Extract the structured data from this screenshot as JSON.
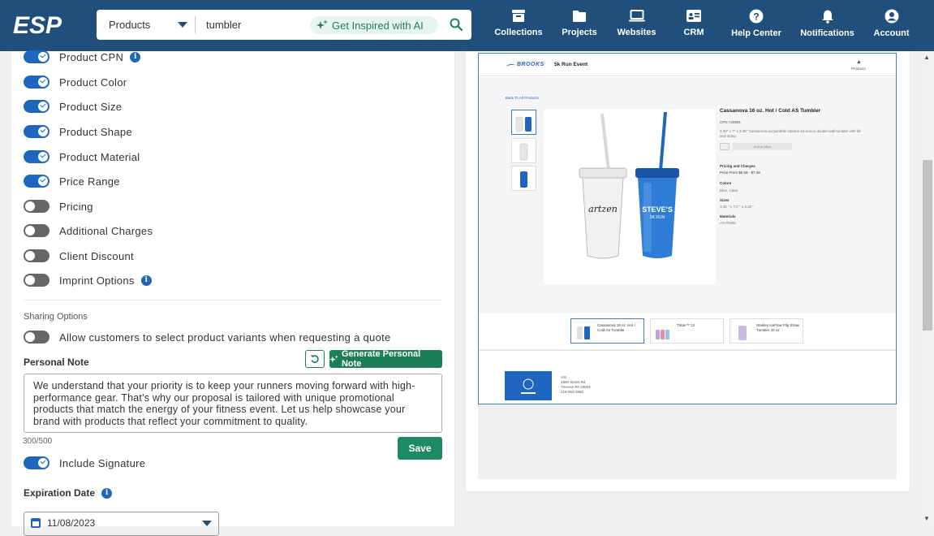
{
  "header": {
    "logo_text": "ESP",
    "search": {
      "scope": "Products",
      "query": "tumbler",
      "ai_label": "Get Inspired with AI"
    },
    "nav": [
      {
        "label": "Collections",
        "icon": "archive-box-icon"
      },
      {
        "label": "Projects",
        "icon": "folder-icon"
      },
      {
        "label": "Websites",
        "icon": "monitor-icon"
      },
      {
        "label": "CRM",
        "icon": "id-card-icon"
      },
      {
        "label": "Help Center",
        "icon": "help-circle-icon"
      },
      {
        "label": "Notifications",
        "icon": "bell-icon"
      },
      {
        "label": "Account",
        "icon": "user-circle-icon"
      }
    ]
  },
  "options": [
    {
      "label": "Product CPN",
      "on": true,
      "info": true
    },
    {
      "label": "Product Color",
      "on": true,
      "info": false
    },
    {
      "label": "Product Size",
      "on": true,
      "info": false
    },
    {
      "label": "Product Shape",
      "on": true,
      "info": false
    },
    {
      "label": "Product Material",
      "on": true,
      "info": false
    },
    {
      "label": "Price Range",
      "on": true,
      "info": false
    },
    {
      "label": "Pricing",
      "on": false,
      "info": false
    },
    {
      "label": "Additional Charges",
      "on": false,
      "info": false
    },
    {
      "label": "Client Discount",
      "on": false,
      "info": false
    },
    {
      "label": "Imprint Options",
      "on": false,
      "info": true
    }
  ],
  "sharing": {
    "heading": "Sharing Options",
    "variant_toggle_label": "Allow customers to select product variants when requesting a quote",
    "variant_toggle_on": false
  },
  "personal_note": {
    "heading": "Personal Note",
    "generate_label": "Generate Personal Note",
    "text": "We understand that your priority is to keep your runners moving forward with high-performance gear. That's why our proposal is tailored with unique promotional products that match the energy of your fitness event. Let us help showcase your brand with products that reflect your commitment to quality.",
    "counter": "300/500",
    "save_label": "Save",
    "signature_label": "Include Signature",
    "signature_on": true
  },
  "expiration": {
    "heading": "Expiration Date",
    "value": "11/08/2023"
  },
  "preview": {
    "brand": "BROOKS",
    "event": "5k Run Event",
    "products_link": "Products",
    "back_link": "Back To All Products",
    "product_title": "Cassanova 16 oz. Hot / Cold AS Tumbler",
    "cpn": "CPN-729881",
    "description": "3.38\" x 7\" x 3.38\" Cassanova acrylonitrile styrene 16-ounce double-wall tumbler with lid and straw.",
    "add_button": "Add product",
    "pricing_heading": "Pricing and Charges",
    "pricing_value": "Price From $5.59 - $7.49",
    "colors_heading": "Colors",
    "colors_value": "Blue, Clear",
    "sizes_heading": "Sizes",
    "sizes_value": "3.38 \" x 7.0 \" x 3.38 \"",
    "materials_heading": "Materials",
    "materials_value": "AS Plastic",
    "related": [
      {
        "name": "Cassanova 16 oz. Hot / Cold AS Tumbler",
        "selected": true
      },
      {
        "name": "Tritan™ 12",
        "selected": false
      },
      {
        "name": "Stanley IceFlow Flip Straw Tumbler 20 oz",
        "selected": false
      }
    ],
    "footer_name": "ASI",
    "footer_address_1": "4800 Street Rd",
    "footer_address_2": "Trevose PA 19053",
    "footer_phone": "215-953-3582"
  }
}
